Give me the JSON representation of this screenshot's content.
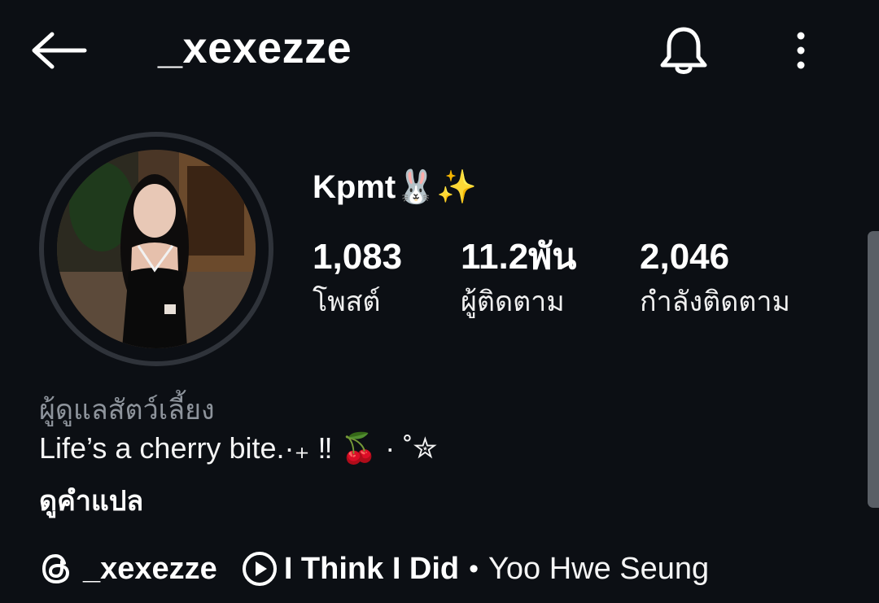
{
  "header": {
    "username": "_xexezze",
    "back_icon": "arrow-left-icon",
    "notifications_icon": "bell-icon",
    "more_icon": "vertical-dots-icon"
  },
  "profile": {
    "display_name": "Kpmt🐰✨",
    "stats": [
      {
        "value": "1,083",
        "label": "โพสต์"
      },
      {
        "value": "11.2พัน",
        "label": "ผู้ติดตาม"
      },
      {
        "value": "2,046",
        "label": "กำลังติดตาม"
      }
    ],
    "category": "ผู้ดูแลสัตว์เลี้ยง",
    "bio": "Life’s a cherry bite.·₊ ‼ 🍒 · ˚✮",
    "translate_label": "ดูคำแปล",
    "threads_handle": "_xexezze",
    "music": {
      "title": "I Think I Did",
      "separator": "•",
      "artist": "Yoo Hwe Seung"
    }
  },
  "colors": {
    "background": "#0c0f14",
    "text_primary": "#ffffff",
    "text_secondary": "#8e949c",
    "avatar_ring": "#2f333a"
  }
}
